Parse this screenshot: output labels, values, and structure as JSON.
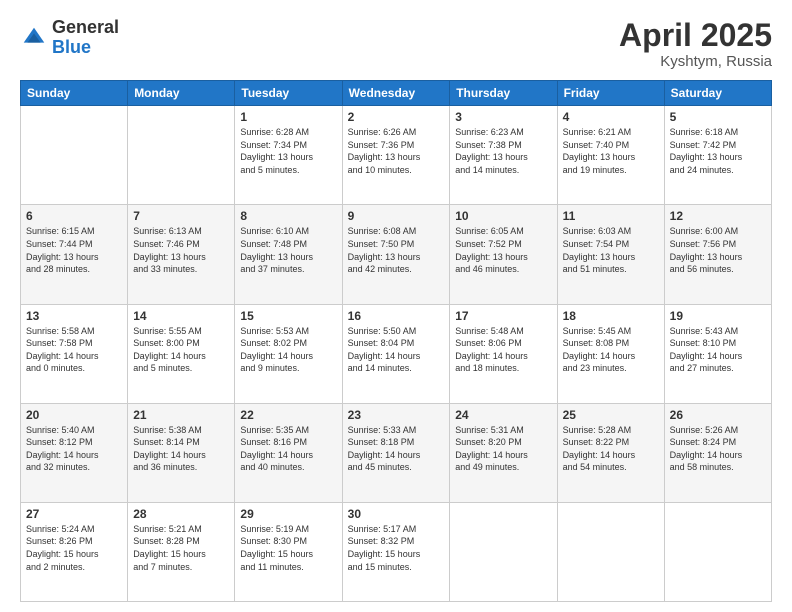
{
  "header": {
    "logo_line1": "General",
    "logo_line2": "Blue",
    "month": "April 2025",
    "location": "Kyshtym, Russia"
  },
  "weekdays": [
    "Sunday",
    "Monday",
    "Tuesday",
    "Wednesday",
    "Thursday",
    "Friday",
    "Saturday"
  ],
  "weeks": [
    [
      {
        "day": "",
        "info": ""
      },
      {
        "day": "",
        "info": ""
      },
      {
        "day": "1",
        "info": "Sunrise: 6:28 AM\nSunset: 7:34 PM\nDaylight: 13 hours\nand 5 minutes."
      },
      {
        "day": "2",
        "info": "Sunrise: 6:26 AM\nSunset: 7:36 PM\nDaylight: 13 hours\nand 10 minutes."
      },
      {
        "day": "3",
        "info": "Sunrise: 6:23 AM\nSunset: 7:38 PM\nDaylight: 13 hours\nand 14 minutes."
      },
      {
        "day": "4",
        "info": "Sunrise: 6:21 AM\nSunset: 7:40 PM\nDaylight: 13 hours\nand 19 minutes."
      },
      {
        "day": "5",
        "info": "Sunrise: 6:18 AM\nSunset: 7:42 PM\nDaylight: 13 hours\nand 24 minutes."
      }
    ],
    [
      {
        "day": "6",
        "info": "Sunrise: 6:15 AM\nSunset: 7:44 PM\nDaylight: 13 hours\nand 28 minutes."
      },
      {
        "day": "7",
        "info": "Sunrise: 6:13 AM\nSunset: 7:46 PM\nDaylight: 13 hours\nand 33 minutes."
      },
      {
        "day": "8",
        "info": "Sunrise: 6:10 AM\nSunset: 7:48 PM\nDaylight: 13 hours\nand 37 minutes."
      },
      {
        "day": "9",
        "info": "Sunrise: 6:08 AM\nSunset: 7:50 PM\nDaylight: 13 hours\nand 42 minutes."
      },
      {
        "day": "10",
        "info": "Sunrise: 6:05 AM\nSunset: 7:52 PM\nDaylight: 13 hours\nand 46 minutes."
      },
      {
        "day": "11",
        "info": "Sunrise: 6:03 AM\nSunset: 7:54 PM\nDaylight: 13 hours\nand 51 minutes."
      },
      {
        "day": "12",
        "info": "Sunrise: 6:00 AM\nSunset: 7:56 PM\nDaylight: 13 hours\nand 56 minutes."
      }
    ],
    [
      {
        "day": "13",
        "info": "Sunrise: 5:58 AM\nSunset: 7:58 PM\nDaylight: 14 hours\nand 0 minutes."
      },
      {
        "day": "14",
        "info": "Sunrise: 5:55 AM\nSunset: 8:00 PM\nDaylight: 14 hours\nand 5 minutes."
      },
      {
        "day": "15",
        "info": "Sunrise: 5:53 AM\nSunset: 8:02 PM\nDaylight: 14 hours\nand 9 minutes."
      },
      {
        "day": "16",
        "info": "Sunrise: 5:50 AM\nSunset: 8:04 PM\nDaylight: 14 hours\nand 14 minutes."
      },
      {
        "day": "17",
        "info": "Sunrise: 5:48 AM\nSunset: 8:06 PM\nDaylight: 14 hours\nand 18 minutes."
      },
      {
        "day": "18",
        "info": "Sunrise: 5:45 AM\nSunset: 8:08 PM\nDaylight: 14 hours\nand 23 minutes."
      },
      {
        "day": "19",
        "info": "Sunrise: 5:43 AM\nSunset: 8:10 PM\nDaylight: 14 hours\nand 27 minutes."
      }
    ],
    [
      {
        "day": "20",
        "info": "Sunrise: 5:40 AM\nSunset: 8:12 PM\nDaylight: 14 hours\nand 32 minutes."
      },
      {
        "day": "21",
        "info": "Sunrise: 5:38 AM\nSunset: 8:14 PM\nDaylight: 14 hours\nand 36 minutes."
      },
      {
        "day": "22",
        "info": "Sunrise: 5:35 AM\nSunset: 8:16 PM\nDaylight: 14 hours\nand 40 minutes."
      },
      {
        "day": "23",
        "info": "Sunrise: 5:33 AM\nSunset: 8:18 PM\nDaylight: 14 hours\nand 45 minutes."
      },
      {
        "day": "24",
        "info": "Sunrise: 5:31 AM\nSunset: 8:20 PM\nDaylight: 14 hours\nand 49 minutes."
      },
      {
        "day": "25",
        "info": "Sunrise: 5:28 AM\nSunset: 8:22 PM\nDaylight: 14 hours\nand 54 minutes."
      },
      {
        "day": "26",
        "info": "Sunrise: 5:26 AM\nSunset: 8:24 PM\nDaylight: 14 hours\nand 58 minutes."
      }
    ],
    [
      {
        "day": "27",
        "info": "Sunrise: 5:24 AM\nSunset: 8:26 PM\nDaylight: 15 hours\nand 2 minutes."
      },
      {
        "day": "28",
        "info": "Sunrise: 5:21 AM\nSunset: 8:28 PM\nDaylight: 15 hours\nand 7 minutes."
      },
      {
        "day": "29",
        "info": "Sunrise: 5:19 AM\nSunset: 8:30 PM\nDaylight: 15 hours\nand 11 minutes."
      },
      {
        "day": "30",
        "info": "Sunrise: 5:17 AM\nSunset: 8:32 PM\nDaylight: 15 hours\nand 15 minutes."
      },
      {
        "day": "",
        "info": ""
      },
      {
        "day": "",
        "info": ""
      },
      {
        "day": "",
        "info": ""
      }
    ]
  ]
}
